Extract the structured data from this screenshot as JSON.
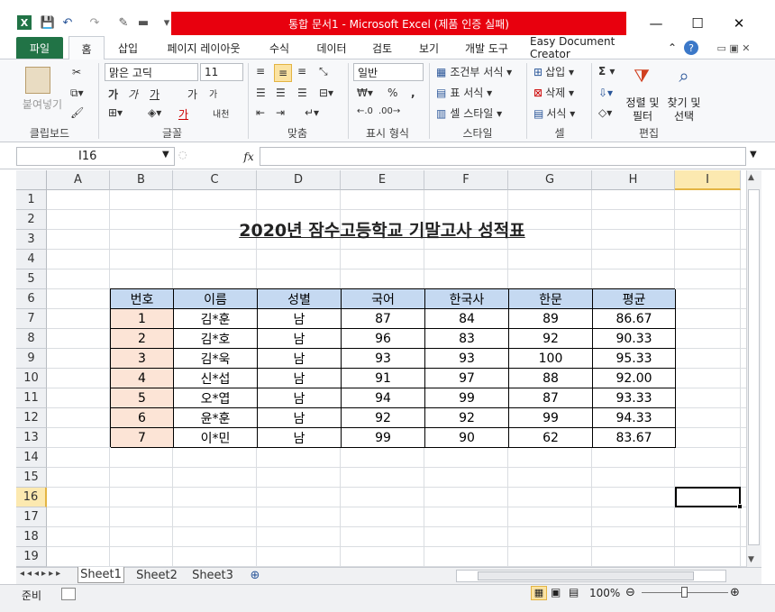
{
  "window": {
    "title": "통합 문서1 - Microsoft Excel (제품 인증 실패)",
    "minimize": "—",
    "maximize": "☐",
    "close": "✕"
  },
  "qat": {
    "save": "💾",
    "undo": "↶",
    "redo": "↷"
  },
  "tabs": [
    "파일",
    "홈",
    "삽입",
    "페이지 레이아웃",
    "수식",
    "데이터",
    "검토",
    "보기",
    "개발 도구",
    "Easy Document Creator"
  ],
  "ribbon": {
    "clipboard": {
      "paste": "붙여넣기",
      "group": "클립보드"
    },
    "font": {
      "name": "맑은 고딕",
      "size": "11",
      "group": "글꼴",
      "bold": "가",
      "italic": "가",
      "underline": "가",
      "grow": "가",
      "shrink": "가",
      "color": "가",
      "phonetic": "내천"
    },
    "align": {
      "group": "맞춤"
    },
    "number": {
      "format": "일반",
      "pct": "%",
      "comma": ",",
      "group": "표시 형식"
    },
    "styles": {
      "cond": "조건부 서식",
      "table": "표 서식",
      "cell": "셀 스타일",
      "group": "스타일"
    },
    "cells": {
      "insert": "삽입",
      "delete": "삭제",
      "format": "서식",
      "group": "셀"
    },
    "edit": {
      "sum": "Σ",
      "sort": "정렬 및",
      "sort2": "필터",
      "find": "찾기 및",
      "find2": "선택",
      "group": "편집"
    }
  },
  "namebox": "I16",
  "fx": "fx",
  "columns": [
    "A",
    "B",
    "C",
    "D",
    "E",
    "F",
    "G",
    "H",
    "I"
  ],
  "rows": [
    "1",
    "2",
    "3",
    "4",
    "5",
    "6",
    "7",
    "8",
    "9",
    "10",
    "11",
    "12",
    "13",
    "14",
    "15",
    "16",
    "17",
    "18",
    "19"
  ],
  "sheet_title": "2020년 잠수고등학교 기말고사 성적표",
  "table": {
    "headers": [
      "번호",
      "이름",
      "성별",
      "국어",
      "한국사",
      "한문",
      "평균"
    ],
    "rows": [
      [
        "1",
        "김*훈",
        "남",
        "87",
        "84",
        "89",
        "86.67"
      ],
      [
        "2",
        "김*호",
        "남",
        "96",
        "83",
        "92",
        "90.33"
      ],
      [
        "3",
        "김*욱",
        "남",
        "93",
        "93",
        "100",
        "95.33"
      ],
      [
        "4",
        "신*섭",
        "남",
        "91",
        "97",
        "88",
        "92.00"
      ],
      [
        "5",
        "오*엽",
        "남",
        "94",
        "99",
        "87",
        "93.33"
      ],
      [
        "6",
        "윤*훈",
        "남",
        "92",
        "92",
        "99",
        "94.33"
      ],
      [
        "7",
        "이*민",
        "남",
        "99",
        "90",
        "62",
        "83.67"
      ]
    ]
  },
  "sheets": [
    "Sheet1",
    "Sheet2",
    "Sheet3"
  ],
  "status": {
    "ready": "준비",
    "zoom": "100%"
  },
  "colors": {
    "header_fill": "#c5d9f1",
    "number_fill": "#fce4d6",
    "excel_green": "#217346",
    "title_red": "#e8000e"
  }
}
